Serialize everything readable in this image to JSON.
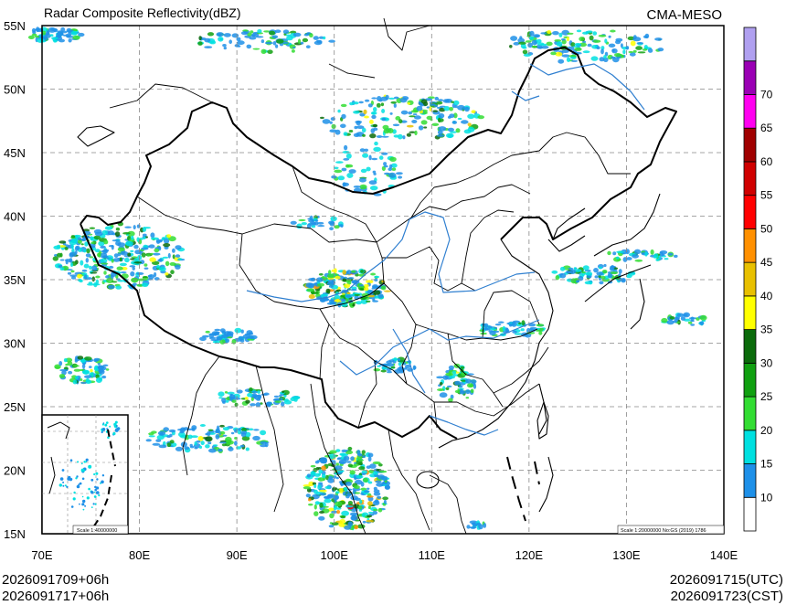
{
  "title": "Radar Composite Reflectivity(dBZ)",
  "source": "CMA-MESO",
  "lat_labels": [
    "55N",
    "50N",
    "45N",
    "40N",
    "35N",
    "30N",
    "25N",
    "20N",
    "15N"
  ],
  "lon_labels": [
    "70E",
    "80E",
    "90E",
    "100E",
    "110E",
    "120E",
    "130E",
    "140E"
  ],
  "map": {
    "lon_range": [
      70,
      140
    ],
    "lat_range": [
      15,
      55
    ],
    "grid": "dashed, 5 degree latitude / 10 degree longitude"
  },
  "colorbar": {
    "labels": [
      "10",
      "15",
      "20",
      "25",
      "30",
      "35",
      "40",
      "45",
      "50",
      "55",
      "60",
      "65",
      "70"
    ],
    "colors": [
      "#ffffff",
      "#1e90e8",
      "#00e0e0",
      "#33dd33",
      "#10a010",
      "#0b6b0b",
      "#ffff00",
      "#e8c000",
      "#ff9000",
      "#ff0000",
      "#d00000",
      "#a00000",
      "#ff00f0",
      "#9a00b4",
      "#b0a0f0"
    ]
  },
  "inset": {
    "scale_label": "Scale 1:40000000"
  },
  "scale_note": "Scale 1:20000000 No:GS (2019) 1786",
  "footer": {
    "left_line1": "2026091709+06h",
    "left_line2": "2026091717+06h",
    "right_line1": "2026091715(UTC)",
    "right_line2": "2026091723(CST)"
  }
}
